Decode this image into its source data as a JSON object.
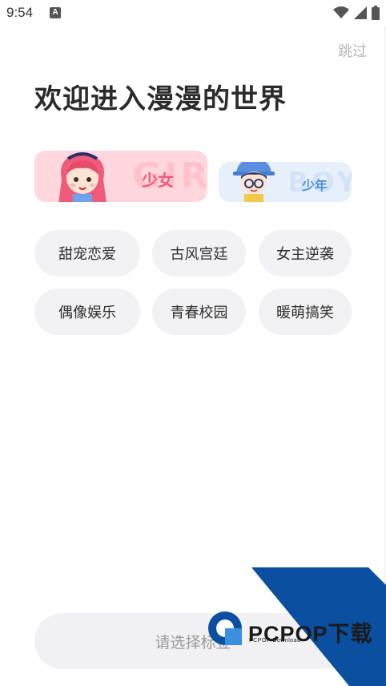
{
  "status_bar": {
    "time": "9:54",
    "notification_letter": "A"
  },
  "header": {
    "skip_label": "跳过",
    "title": "欢迎进入漫漫的世界"
  },
  "gender_cards": [
    {
      "label": "少女",
      "bg_word": "GIRL"
    },
    {
      "label": "少年",
      "bg_word": "BOY"
    }
  ],
  "tags": [
    "甜宠恋爱",
    "古风宫廷",
    "女主逆袭",
    "偶像娱乐",
    "青春校园",
    "暖萌搞笑"
  ],
  "confirm": {
    "label": "请选择标签"
  },
  "watermark": {
    "brand": "PCPOP下载",
    "sub": "PCPOP Download"
  },
  "colors": {
    "girl_accent": "#ef5b7a",
    "boy_accent": "#4f8ee4",
    "watermark_blue": "#0a4fa0"
  }
}
